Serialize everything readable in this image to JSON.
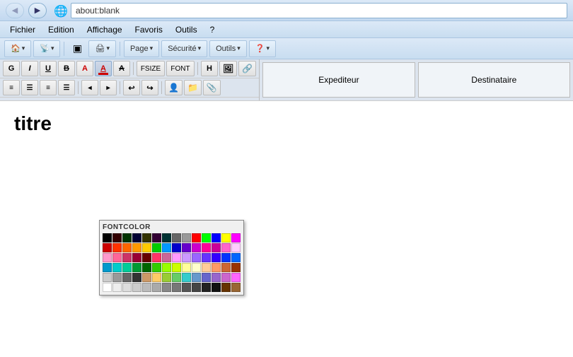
{
  "browser": {
    "back_title": "Back",
    "forward_title": "Forward",
    "ie_icon": "🌐",
    "address": "about:blank",
    "address_placeholder": "about:blank"
  },
  "menu": {
    "items": [
      "Fichier",
      "Edition",
      "Affichage",
      "Favoris",
      "Outils",
      "?"
    ]
  },
  "toolbar": {
    "home_icon": "🏠",
    "feed_icon": "📡",
    "print_icon": "🖨",
    "page_label": "Page",
    "security_label": "Sécurité",
    "tools_label": "Outils",
    "help_icon": "❓"
  },
  "editor": {
    "row1_buttons": [
      {
        "id": "bold",
        "label": "G",
        "bold": true
      },
      {
        "id": "italic",
        "label": "I",
        "italic": true
      },
      {
        "id": "underline",
        "label": "U",
        "underline": true
      },
      {
        "id": "strikethrough",
        "label": "B"
      },
      {
        "id": "font-color",
        "label": "A",
        "colored": true
      },
      {
        "id": "font-color2",
        "label": "A",
        "bg_color": true,
        "active": true
      },
      {
        "id": "font-color3",
        "label": "A",
        "strikethrough": true
      },
      {
        "id": "font-size",
        "label": "FSIZE",
        "wide": true
      },
      {
        "id": "font-face",
        "label": "FONT",
        "wide": true
      },
      {
        "id": "heading",
        "label": "H"
      },
      {
        "id": "image",
        "label": "IMG"
      }
    ],
    "row2_buttons": [
      {
        "id": "align-left"
      },
      {
        "id": "align-center"
      },
      {
        "id": "align-right"
      },
      {
        "id": "align-justify"
      },
      {
        "id": "indent-less"
      },
      {
        "id": "indent-more"
      },
      {
        "id": "undo"
      },
      {
        "id": "redo"
      },
      {
        "id": "person"
      },
      {
        "id": "folder"
      },
      {
        "id": "link"
      }
    ],
    "right_buttons": [
      "Expediteur",
      "Destinataire"
    ],
    "content": {
      "title": "titre"
    }
  },
  "color_picker": {
    "label": "FONTCOLOR",
    "colors": [
      "#000000",
      "#330000",
      "#003300",
      "#000033",
      "#333300",
      "#330033",
      "#003333",
      "#666666",
      "#999999",
      "#ff0000",
      "#00ff00",
      "#0000ff",
      "#ffff00",
      "#ff00ff",
      "#cc0000",
      "#ff3300",
      "#ff6600",
      "#ff9900",
      "#ffcc00",
      "#00cc00",
      "#0099ff",
      "#0000cc",
      "#6600cc",
      "#cc00cc",
      "#ff0099",
      "#cc0099",
      "#ff66cc",
      "#ffccff",
      "#ff99cc",
      "#ff6699",
      "#cc3366",
      "#990033",
      "#660000",
      "#ff3366",
      "#cc6699",
      "#ff99ff",
      "#cc99ff",
      "#9966ff",
      "#6633ff",
      "#3300ff",
      "#0033ff",
      "#0066ff",
      "#0099cc",
      "#00cccc",
      "#00cc99",
      "#009933",
      "#006600",
      "#33cc00",
      "#99ff00",
      "#ccff00",
      "#ffff99",
      "#ffffcc",
      "#ffcc99",
      "#ff9966",
      "#cc6633",
      "#993300",
      "#cccccc",
      "#999999",
      "#666666",
      "#333333",
      "#cc9966",
      "#ffcc66",
      "#99cc33",
      "#66cc66",
      "#33cccc",
      "#6699cc",
      "#6666cc",
      "#9966cc",
      "#cc66cc",
      "#ff66ff",
      "#ffffff",
      "#eeeeee",
      "#dddddd",
      "#cccccc",
      "#bbbbbb",
      "#aaaaaa",
      "#888888",
      "#777777",
      "#555555",
      "#444444",
      "#222222",
      "#111111",
      "#663300",
      "#996633"
    ]
  }
}
